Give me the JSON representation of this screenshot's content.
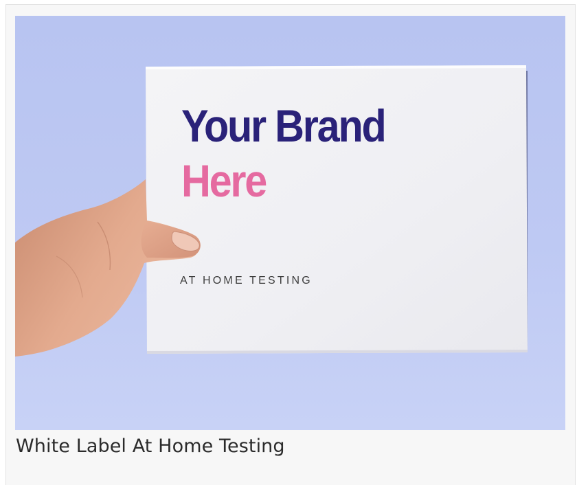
{
  "figure": {
    "caption": "White Label At Home Testing"
  },
  "box": {
    "brand_line1": "Your Brand",
    "brand_line2": "Here",
    "tagline": "AT HOME TESTING"
  },
  "colors": {
    "background": "#bcc7f2",
    "box": "#f2f2f4",
    "brand_primary": "#2a2279",
    "brand_accent": "#e56aa0",
    "skin": "#e2a88c"
  }
}
